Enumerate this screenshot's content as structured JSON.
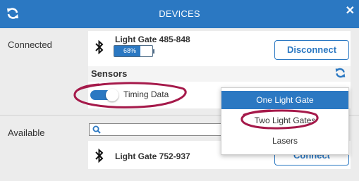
{
  "window": {
    "title": "DEVICES",
    "close_glyph": "✕"
  },
  "icons": {
    "refresh": "refresh-icon",
    "close": "close-icon",
    "bluetooth": "bluetooth-icon",
    "search": "search-icon"
  },
  "colors": {
    "accent": "#2b78c2",
    "annotation": "#a5194a"
  },
  "connected": {
    "label": "Connected",
    "device": {
      "name": "Light Gate 485-848",
      "battery_text": "68%",
      "battery_level": 0.68
    },
    "disconnect_label": "Disconnect",
    "sensors": {
      "header": "Sensors",
      "toggle": {
        "label": "Timing Data",
        "on": true
      }
    }
  },
  "dropdown": {
    "options": [
      {
        "label": "One Light Gate",
        "selected": true
      },
      {
        "label": "Two Light Gates",
        "selected": false
      },
      {
        "label": "Lasers",
        "selected": false
      }
    ]
  },
  "available": {
    "label": "Available",
    "search": {
      "value": "",
      "placeholder": ""
    },
    "device": {
      "name": "Light Gate 752-937"
    },
    "connect_label": "Connect"
  }
}
